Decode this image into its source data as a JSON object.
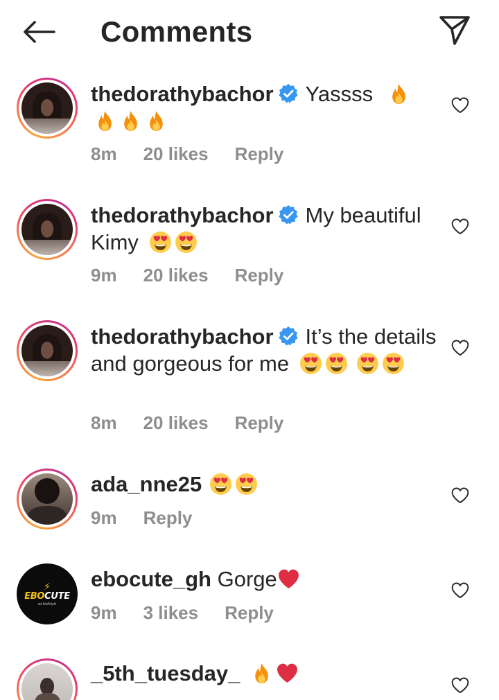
{
  "header": {
    "title": "Comments",
    "back_icon": "arrow-left-icon",
    "send_icon": "paper-plane-icon"
  },
  "icons": {
    "verified": "verified-badge-icon",
    "like": "heart-outline-icon",
    "fire": "fire-emoji",
    "heart_eyes": "heart-eyes-emoji",
    "red_heart": "red-heart-emoji"
  },
  "colors": {
    "verified_blue": "#3897f0",
    "meta_gray": "#8e8e8e",
    "ring_start": "#f9a43a",
    "ring_end": "#c5328b"
  },
  "avatar_logo": {
    "bolt": "⚡",
    "brand_a": "EBO",
    "brand_b": "CUTE",
    "tagline": "ad bluffstyle"
  },
  "comments": [
    {
      "username": "thedorathybachor",
      "verified": true,
      "text": "Yassss",
      "time": "8m",
      "likes": "20 likes",
      "reply": "Reply"
    },
    {
      "username": "thedorathybachor",
      "verified": true,
      "text": "My beautiful Kimy",
      "time": "9m",
      "likes": "20 likes",
      "reply": "Reply"
    },
    {
      "username": "thedorathybachor",
      "verified": true,
      "text": "It’s the details and gorgeous for me",
      "time": "8m",
      "likes": "20 likes",
      "reply": "Reply"
    },
    {
      "username": "ada_nne25",
      "verified": false,
      "text": "",
      "time": "9m",
      "likes": "",
      "reply": "Reply"
    },
    {
      "username": "ebocute_gh",
      "verified": false,
      "text": "Gorge",
      "time": "9m",
      "likes": "3 likes",
      "reply": "Reply"
    },
    {
      "username": "_5th_tuesday_",
      "verified": false,
      "text": "",
      "time": "",
      "likes": "",
      "reply": ""
    }
  ]
}
